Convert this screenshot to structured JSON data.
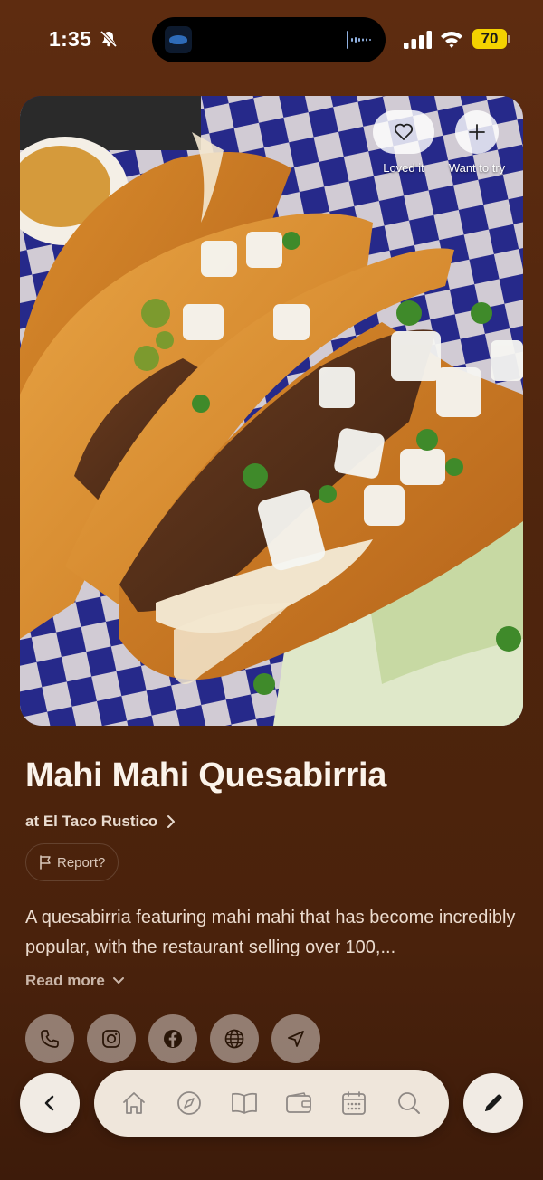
{
  "status_bar": {
    "time": "1:35",
    "battery": "70",
    "icons": [
      "bell-slash-icon",
      "signal-icon",
      "wifi-icon",
      "battery-icon"
    ]
  },
  "hero": {
    "actions": [
      {
        "icon": "heart-icon",
        "label": "Loved it"
      },
      {
        "icon": "plus-icon",
        "label": "Want to try"
      }
    ]
  },
  "dish": {
    "title": "Mahi Mahi Quesabirria",
    "venue": "at El Taco Rustico",
    "report_label": "Report?",
    "description": "A quesabirria featuring mahi mahi that has become incredibly popular, with the restaurant selling over 100,...",
    "read_more": "Read more"
  },
  "contact_actions": [
    "phone-icon",
    "instagram-icon",
    "facebook-icon",
    "globe-icon",
    "navigation-arrow-icon"
  ],
  "bottom_bar": {
    "back_icon": "chevron-left-icon",
    "nav_items": [
      "home-icon",
      "compass-icon",
      "book-icon",
      "wallet-icon",
      "calendar-icon",
      "search-icon"
    ],
    "edit_icon": "pencil-icon"
  },
  "colors": {
    "background": "#5e2c10",
    "pill": "#efe6db",
    "battery": "#f4d200"
  }
}
